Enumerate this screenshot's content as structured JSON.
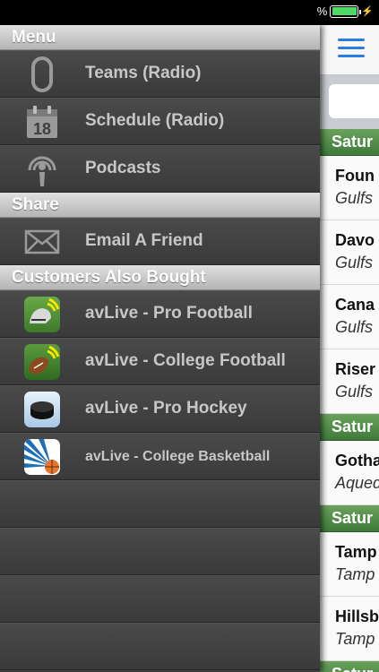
{
  "status_bar": {
    "battery_percent_text": "%",
    "battery_level": 1.0,
    "charging": true
  },
  "drawer": {
    "sections": [
      {
        "title": "Menu"
      },
      {
        "title": "Share"
      },
      {
        "title": "Customers Also Bought"
      }
    ],
    "menu_items": [
      {
        "label": "Teams (Radio)",
        "icon": "oval-ring-icon"
      },
      {
        "label": "Schedule (Radio)",
        "icon": "calendar-icon",
        "icon_text": "18"
      },
      {
        "label": "Podcasts",
        "icon": "podcast-icon"
      }
    ],
    "share_items": [
      {
        "label": "Email A Friend",
        "icon": "envelope-icon"
      }
    ],
    "bought_items": [
      {
        "label": "avLive - Pro Football",
        "icon": "pro-football-app-icon"
      },
      {
        "label": "avLive - College Football",
        "icon": "college-football-app-icon"
      },
      {
        "label": "avLive - Pro Hockey",
        "icon": "pro-hockey-app-icon"
      },
      {
        "label": "avLive - College Basketball",
        "icon": "college-basketball-app-icon"
      }
    ]
  },
  "main": {
    "day_headers": [
      "Satur",
      "Satur",
      "Satur",
      "Satur"
    ],
    "games": [
      {
        "title": "Foun",
        "subtitle": "Gulfs"
      },
      {
        "title": "Davo",
        "subtitle": "Gulfs"
      },
      {
        "title": "Cana",
        "subtitle": "Gulfs"
      },
      {
        "title": "Riser",
        "subtitle": "Gulfs"
      },
      {
        "title": "Gotha",
        "subtitle": "Aqued"
      },
      {
        "title": "Tamp",
        "subtitle": "Tamp"
      },
      {
        "title": "Hillsb",
        "subtitle": "Tamp"
      }
    ]
  },
  "colors": {
    "accent": "#2a7de1",
    "header_green": "#4a8a44",
    "drawer_bg": "#3f3f3f"
  }
}
